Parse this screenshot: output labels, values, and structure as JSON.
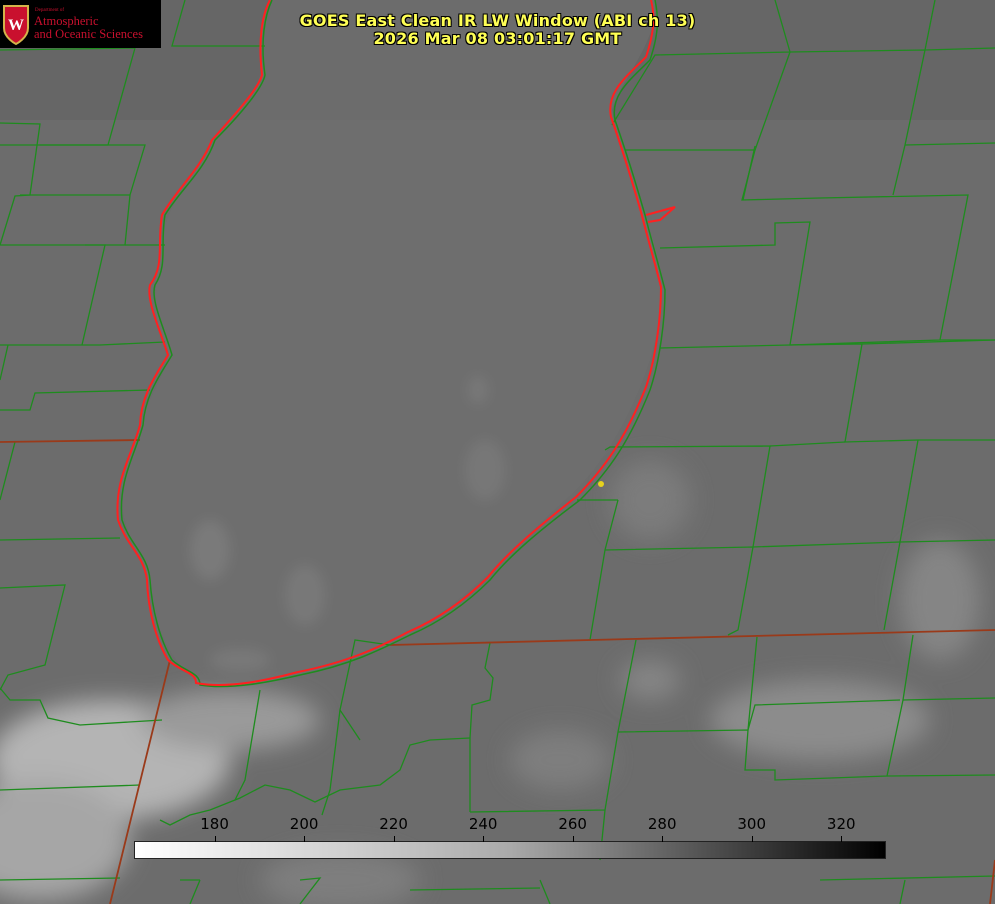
{
  "title_line1": "GOES East Clean IR LW Window (ABI ch 13)",
  "title_line2": "2026 Mar 08 03:01:17 GMT",
  "logo": {
    "department": "Department of",
    "line1": "Atmospheric",
    "line2": "and Oceanic Sciences",
    "crest_letter": "W"
  },
  "colorbar": {
    "ticks": [
      "180",
      "200",
      "220",
      "240",
      "260",
      "280",
      "300",
      "320"
    ],
    "tick_values": [
      180,
      200,
      220,
      240,
      260,
      280,
      300,
      320
    ],
    "range": [
      162,
      330
    ]
  },
  "colors": {
    "title": "#ffff55",
    "coastline": "#ff2020",
    "boundaries": "#1e8c1e",
    "marker": "#e6d21e",
    "logo_text": "#c9102e"
  },
  "icons": [
    "wisconsin-crest-icon",
    "station-marker-icon"
  ]
}
